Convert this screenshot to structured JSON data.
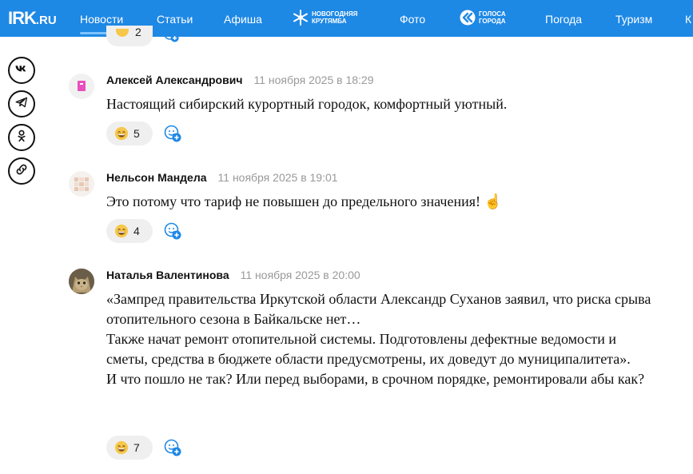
{
  "header": {
    "logo_main": "IRK",
    "logo_suffix": ".RU",
    "nav": [
      {
        "label": "Новости",
        "active": true
      },
      {
        "label": "Статьи"
      },
      {
        "label": "Афиша"
      },
      {
        "label": "Фото"
      },
      {
        "label": "Погода"
      },
      {
        "label": "Туризм"
      }
    ],
    "promo_krutyamba": {
      "line1": "Новогодняя",
      "line2": "крутямба"
    },
    "promo_golosa": {
      "line1": "голоса",
      "line2": "города"
    },
    "colors": {
      "header_bg": "#1e88e5",
      "active_underline": "#7ec3ff"
    }
  },
  "share_icons": [
    "vk-icon",
    "telegram-icon",
    "odnoklassniki-icon",
    "copy-link-icon"
  ],
  "partial_reaction": {
    "count": "2"
  },
  "comments": [
    {
      "author": "Алексей Александрович",
      "date": "11 ноября 2025 в 18:29",
      "paragraphs": [
        "Настоящий сибирский курортный городок, комфортный уютный."
      ],
      "reaction_count": "5",
      "avatar": "pink-book-avatar"
    },
    {
      "author": "Нельсон Мандела",
      "date": "11 ноября 2025 в 19:01",
      "paragraphs": [
        "Это потому что тариф не повышен до предельного значения! ☝"
      ],
      "reaction_count": "4",
      "avatar": "pixel-pattern-avatar"
    },
    {
      "author": "Наталья Валентинова",
      "date": "11 ноября 2025 в 20:00",
      "paragraphs": [
        "«Зампред правительства Иркутской области Александр Суханов заявил, что риска срыва отопительного сезона в Байкальске нет…",
        "Также начат ремонт отопительной системы. Подготовлены дефектные ведомости и сметы, средства в бюджете области предусмотрены, их доведут до муниципалитета».",
        "И что пошло не так? Или перед выборами, в срочном порядке, ремонтировали абы как?"
      ],
      "reaction_count": "7",
      "avatar": "cat-photo-avatar"
    }
  ]
}
